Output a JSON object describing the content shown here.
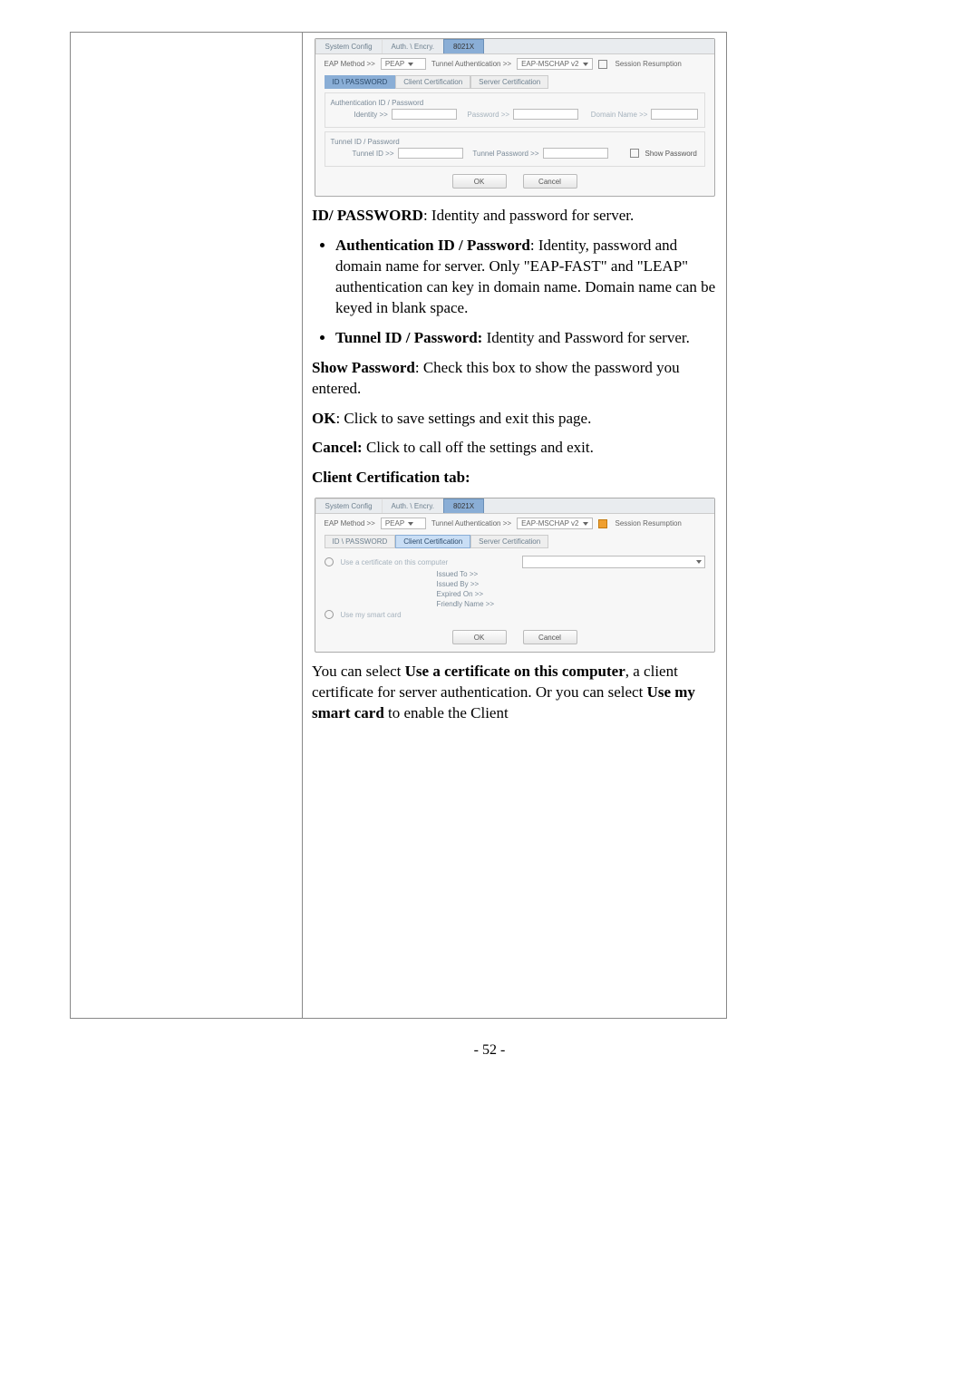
{
  "page_number": "- 52 -",
  "dlg1": {
    "tabs": [
      "System Config",
      "Auth. \\ Encry.",
      "8021X"
    ],
    "eap_method_lbl": "EAP Method >>",
    "eap_method_val": "PEAP",
    "tunnel_auth_lbl": "Tunnel Authentication >>",
    "tunnel_auth_val": "EAP-MSCHAP v2",
    "session_resume": "Session Resumption",
    "subtabs": [
      "ID \\ PASSWORD",
      "Client Certification",
      "Server Certification"
    ],
    "group1_legend": "Authentication ID / Password",
    "identity_lbl": "Identity >>",
    "password_lbl": "Password >>",
    "domain_lbl": "Domain Name >>",
    "group2_legend": "Tunnel ID / Password",
    "tunnel_id_lbl": "Tunnel ID >>",
    "tunnel_pwd_lbl": "Tunnel Password >>",
    "show_pwd": "Show Password",
    "ok": "OK",
    "cancel": "Cancel"
  },
  "body": {
    "p1_bold": "ID/ PASSWORD",
    "p1_rest": ": Identity and password for server.",
    "li1_bold": "Authentication ID / Password",
    "li1_rest": ": Identity, password and domain name for server. Only \"EAP-FAST\" and \"LEAP\" authentication can key in domain name. Domain name can be keyed in blank space.",
    "li2_bold": "Tunnel ID / Password:",
    "li2_rest": " Identity and Password for server.",
    "p2_bold": "Show Password",
    "p2_rest": ": Check this box to show the password you entered.",
    "p3_bold": "OK",
    "p3_rest": ": Click to save settings and exit this page.",
    "p4_bold": "Cancel:",
    "p4_rest": " Click to call off the settings and exit.",
    "h_clientcert": "Client Certification tab:"
  },
  "dlg2": {
    "tabs": [
      "System Config",
      "Auth. \\ Encry.",
      "8021X"
    ],
    "eap_method_lbl": "EAP Method >>",
    "eap_method_val": "PEAP",
    "tunnel_auth_lbl": "Tunnel Authentication >>",
    "tunnel_auth_val": "EAP-MSCHAP v2",
    "session_resume": "Session Resumption",
    "subtabs": [
      "ID \\ PASSWORD",
      "Client Certification",
      "Server Certification"
    ],
    "use_cert": "Use a certificate on this computer",
    "issued_to": "Issued To >>",
    "issued_by": "Issued By >>",
    "expired_on": "Expired On >>",
    "friendly": "Friendly Name >>",
    "use_smart": "Use my smart card",
    "ok": "OK",
    "cancel": "Cancel"
  },
  "bottom": {
    "p_a": "You can select ",
    "p_b_bold": "Use a certificate on this computer",
    "p_c": ", a client certificate for server authentication. Or you can select ",
    "p_d_bold": "Use my smart card",
    "p_e": " to enable the Client"
  }
}
